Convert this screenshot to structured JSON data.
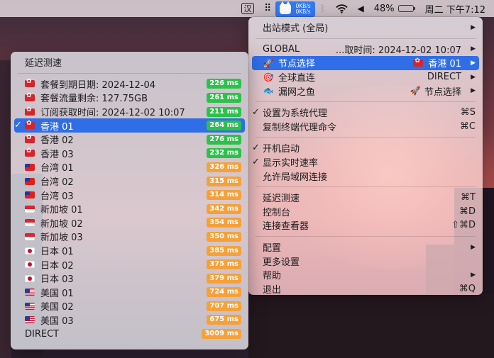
{
  "menubar": {
    "ime_label": "汉",
    "speed_up": "0KB/s",
    "speed_down": "0KB/s",
    "battery_percent": "48%",
    "battery_level": 0.48,
    "datetime": "周二 下午7:12"
  },
  "main_menu": {
    "outbound_mode": "出站模式 (全局)",
    "global_label": "GLOBAL",
    "fetch_time": "...取时间: 2024-12-02 10:07",
    "proxy_groups": [
      {
        "icon": "rocket-icon",
        "label": "节点选择",
        "value": "香港 01",
        "value_flag": "hk-flag-icon",
        "highlighted": true
      },
      {
        "icon": "target-icon",
        "label": "全球直连",
        "value": "DIRECT",
        "highlighted": false
      },
      {
        "icon": "fish-icon",
        "label": "漏网之鱼",
        "value": "节点选择",
        "value_icon": "rocket-icon",
        "highlighted": false
      }
    ],
    "set_system_proxy": {
      "label": "设置为系统代理",
      "shortcut": "⌘S",
      "checked": true
    },
    "copy_terminal_cmd": {
      "label": "复制终端代理命令",
      "shortcut": "⌘C"
    },
    "start_at_login": {
      "label": "开机启动",
      "checked": true
    },
    "show_speed": {
      "label": "显示实时速率",
      "checked": true
    },
    "allow_lan": {
      "label": "允许局域网连接",
      "checked": false
    },
    "latency_test": {
      "label": "延迟测速",
      "shortcut": "⌘T"
    },
    "dashboard": {
      "label": "控制台",
      "shortcut": "⌘D"
    },
    "conn_viewer": {
      "label": "连接查看器",
      "shortcut": "⇧⌘D"
    },
    "config": {
      "label": "配置"
    },
    "more_settings": {
      "label": "更多设置"
    },
    "help": {
      "label": "帮助"
    },
    "quit": {
      "label": "退出",
      "shortcut": "⌘Q"
    }
  },
  "sub_menu": {
    "title": "延迟测速",
    "items": [
      {
        "flag": "hk",
        "label": "套餐到期日期:  2024-12-04",
        "latency": "226 ms",
        "status": "good",
        "selected": false
      },
      {
        "flag": "hk",
        "label": "套餐流量剩余:  127.75GB",
        "latency": "261 ms",
        "status": "good",
        "selected": false
      },
      {
        "flag": "hk",
        "label": "订阅获取时间:  2024-12-02 10:07",
        "latency": "211 ms",
        "status": "good",
        "selected": false
      },
      {
        "flag": "hk",
        "label": "香港 01",
        "latency": "264 ms",
        "status": "good",
        "selected": true
      },
      {
        "flag": "hk",
        "label": "香港 02",
        "latency": "276 ms",
        "status": "good",
        "selected": false
      },
      {
        "flag": "hk",
        "label": "香港 03",
        "latency": "232 ms",
        "status": "good",
        "selected": false
      },
      {
        "flag": "tw",
        "label": "台湾 01",
        "latency": "326 ms",
        "status": "warn",
        "selected": false
      },
      {
        "flag": "tw",
        "label": "台湾 02",
        "latency": "315 ms",
        "status": "warn",
        "selected": false
      },
      {
        "flag": "tw",
        "label": "台湾 03",
        "latency": "314 ms",
        "status": "warn",
        "selected": false
      },
      {
        "flag": "sg",
        "label": "新加坡 01",
        "latency": "342 ms",
        "status": "warn",
        "selected": false
      },
      {
        "flag": "sg",
        "label": "新加坡 02",
        "latency": "354 ms",
        "status": "warn",
        "selected": false
      },
      {
        "flag": "sg",
        "label": "新加坡 03",
        "latency": "350 ms",
        "status": "warn",
        "selected": false
      },
      {
        "flag": "jp",
        "label": "日本 01",
        "latency": "385 ms",
        "status": "warn",
        "selected": false
      },
      {
        "flag": "jp",
        "label": "日本 02",
        "latency": "375 ms",
        "status": "warn",
        "selected": false
      },
      {
        "flag": "jp",
        "label": "日本 03",
        "latency": "379 ms",
        "status": "warn",
        "selected": false
      },
      {
        "flag": "us",
        "label": "美国 01",
        "latency": "724 ms",
        "status": "warn",
        "selected": false
      },
      {
        "flag": "us",
        "label": "美国 02",
        "latency": "707 ms",
        "status": "warn",
        "selected": false
      },
      {
        "flag": "us",
        "label": "美国 03",
        "latency": "675 ms",
        "status": "warn",
        "selected": false
      },
      {
        "flag": "",
        "label": "DIRECT",
        "latency": "3009 ms",
        "status": "warn",
        "selected": false
      }
    ]
  },
  "colors": {
    "highlight": "#2f6ee6",
    "good": "#2cc24a",
    "warn": "#f5a13a",
    "menubar_app": "#3478f6"
  }
}
